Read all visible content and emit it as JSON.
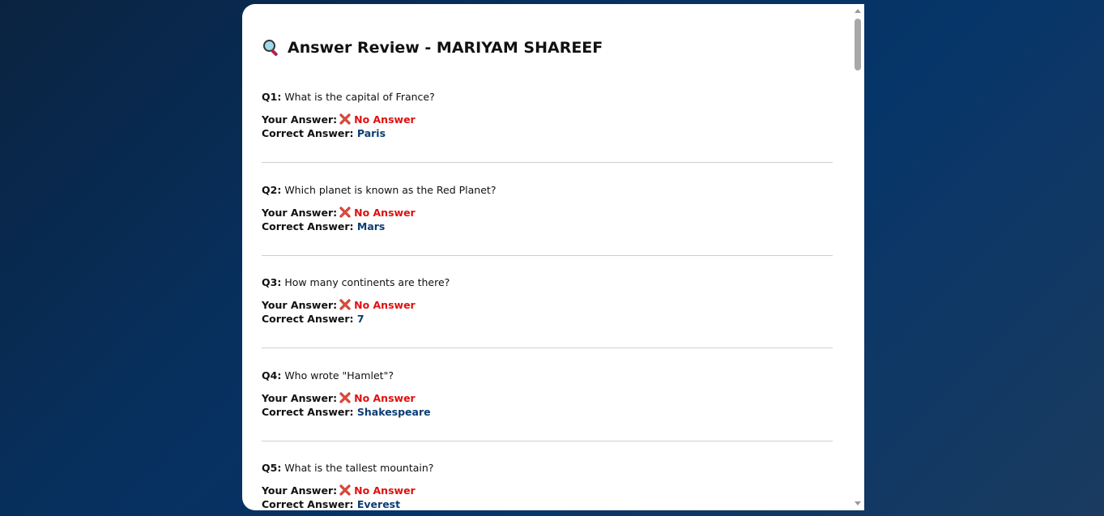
{
  "review": {
    "title": "Answer Review - MARIYAM SHAREEF",
    "your_answer_label": "Your Answer:",
    "correct_answer_label": "Correct Answer:",
    "questions": [
      {
        "num": "Q1:",
        "text": "What is the capital of France?",
        "your_answer": "No Answer",
        "correct": "Paris"
      },
      {
        "num": "Q2:",
        "text": "Which planet is known as the Red Planet?",
        "your_answer": "No Answer",
        "correct": "Mars"
      },
      {
        "num": "Q3:",
        "text": "How many continents are there?",
        "your_answer": "No Answer",
        "correct": "7"
      },
      {
        "num": "Q4:",
        "text": "Who wrote \"Hamlet\"?",
        "your_answer": "No Answer",
        "correct": "Shakespeare"
      },
      {
        "num": "Q5:",
        "text": "What is the tallest mountain?",
        "your_answer": "No Answer",
        "correct": "Everest"
      }
    ]
  },
  "icons": {
    "title_icon": "magnifier-icon",
    "wrong_icon": "cross-mark-icon"
  },
  "colors": {
    "wrong": "#e01010",
    "correct": "#0b3d73"
  }
}
